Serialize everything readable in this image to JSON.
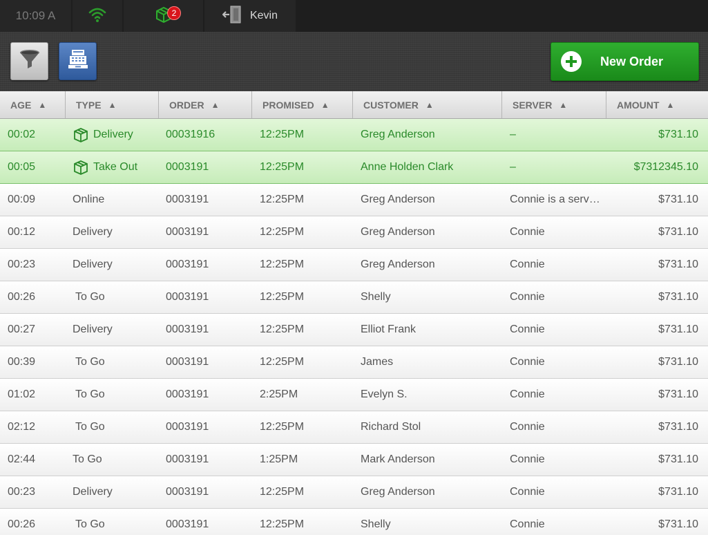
{
  "status_bar": {
    "time": "10:09 A",
    "wifi_icon": "wifi-icon",
    "package_icon": "package-icon",
    "package_badge": "2",
    "logout_icon": "logout-door-icon",
    "user_name": "Kevin"
  },
  "toolbar": {
    "filter_icon": "funnel-icon",
    "register_icon": "cash-register-icon",
    "new_order_label": "New Order"
  },
  "columns": [
    {
      "label": "AGE",
      "arrow": "▲"
    },
    {
      "label": "TYPE",
      "arrow": "▲"
    },
    {
      "label": "ORDER",
      "arrow": "▲"
    },
    {
      "label": "PROMISED",
      "arrow": "▲"
    },
    {
      "label": "CUSTOMER",
      "arrow": "▲"
    },
    {
      "label": "SERVER",
      "arrow": "▲"
    },
    {
      "label": "AMOUNT",
      "arrow": "▲"
    }
  ],
  "rows": [
    {
      "age": "00:02",
      "type": "Delivery",
      "order": "00031916",
      "promised": "12:25PM",
      "customer": "Greg Anderson",
      "server": "–",
      "amount": "$731.10",
      "highlight": true,
      "icon": true
    },
    {
      "age": "00:05",
      "type": "Take Out",
      "order": "0003191",
      "promised": "12:25PM",
      "customer": "Anne Holden Clark",
      "server": "–",
      "amount": "$7312345.10",
      "highlight": true,
      "icon": true
    },
    {
      "age": "00:09",
      "type": "Online",
      "order": "0003191",
      "promised": "12:25PM",
      "customer": "Greg Anderson",
      "server": "Connie is a serv…",
      "amount": "$731.10"
    },
    {
      "age": "00:12",
      "type": "Delivery",
      "order": "0003191",
      "promised": "12:25PM",
      "customer": "Greg Anderson",
      "server": "Connie",
      "amount": "$731.10"
    },
    {
      "age": "00:23",
      "type": "Delivery",
      "order": "0003191",
      "promised": "12:25PM",
      "customer": "Greg Anderson",
      "server": "Connie",
      "amount": "$731.10"
    },
    {
      "age": "00:26",
      "type": "To Go",
      "order": "0003191",
      "promised": "12:25PM",
      "customer": "Shelly",
      "server": "Connie",
      "amount": "$731.10",
      "indent": true
    },
    {
      "age": "00:27",
      "type": "Delivery",
      "order": "0003191",
      "promised": "12:25PM",
      "customer": "Elliot Frank",
      "server": "Connie",
      "amount": "$731.10"
    },
    {
      "age": "00:39",
      "type": "To Go",
      "order": "0003191",
      "promised": "12:25PM",
      "customer": "James",
      "server": "Connie",
      "amount": "$731.10",
      "indent": true
    },
    {
      "age": "01:02",
      "type": "To Go",
      "order": "0003191",
      "promised": "2:25PM",
      "customer": "Evelyn S.",
      "server": "Connie",
      "amount": "$731.10",
      "indent": true
    },
    {
      "age": "02:12",
      "type": "To Go",
      "order": "0003191",
      "promised": "12:25PM",
      "customer": "Richard Stol",
      "server": "Connie",
      "amount": "$731.10",
      "indent": true
    },
    {
      "age": "02:44",
      "type": "To Go",
      "order": "0003191",
      "promised": "1:25PM",
      "customer": "Mark Anderson",
      "server": "Connie",
      "amount": "$731.10"
    },
    {
      "age": "00:23",
      "type": "Delivery",
      "order": "0003191",
      "promised": "12:25PM",
      "customer": "Greg Anderson",
      "server": "Connie",
      "amount": "$731.10"
    },
    {
      "age": "00:26",
      "type": "To Go",
      "order": "0003191",
      "promised": "12:25PM",
      "customer": "Shelly",
      "server": "Connie",
      "amount": "$731.10",
      "indent": true
    }
  ],
  "colors": {
    "accent_green": "#1f9a1f",
    "highlight_row": "#d6f2cb",
    "badge_red": "#d8151b"
  }
}
